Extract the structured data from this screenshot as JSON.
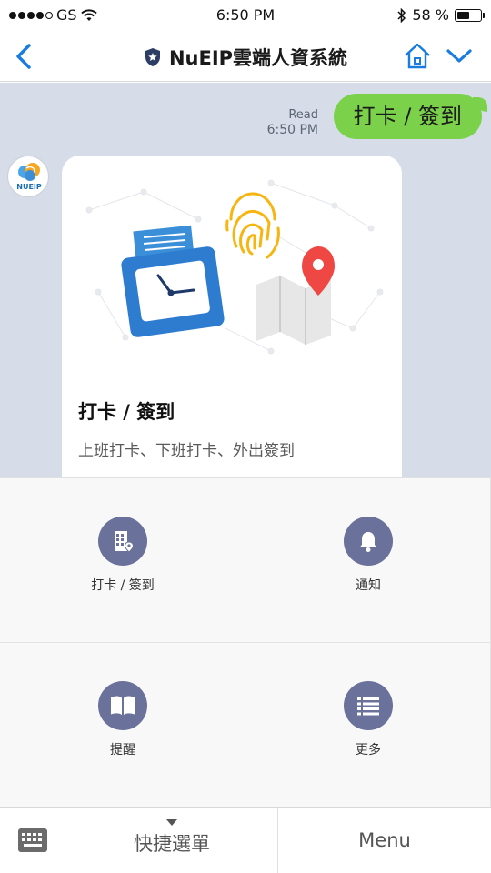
{
  "status_bar": {
    "carrier": "GS",
    "time": "6:50 PM",
    "battery_text": "58 %",
    "battery_level": 0.58,
    "signal_bars_filled": 4
  },
  "nav": {
    "title": "NuEIP雲端人資系統"
  },
  "chat": {
    "read_label": "Read",
    "read_time": "6:50 PM",
    "user_message": "打卡 / 簽到",
    "bot_avatar_text": "NUEIP",
    "card": {
      "title": "打卡 / 簽到",
      "description": "上班打卡、下班打卡、外出簽到"
    }
  },
  "rich_menu": {
    "items": [
      {
        "label": "打卡 / 簽到",
        "icon": "building-pin-icon"
      },
      {
        "label": "通知",
        "icon": "bell-icon"
      },
      {
        "label": "提醒",
        "icon": "book-icon"
      },
      {
        "label": "更多",
        "icon": "list-icon"
      }
    ]
  },
  "bottom_bar": {
    "quick_menu_label": "快捷選單",
    "menu_label": "Menu"
  },
  "colors": {
    "accent_blue": "#1a7ce0",
    "bubble_green": "#7bd24a",
    "chat_bg": "#d6dde8",
    "icon_circle": "#6a719a"
  }
}
